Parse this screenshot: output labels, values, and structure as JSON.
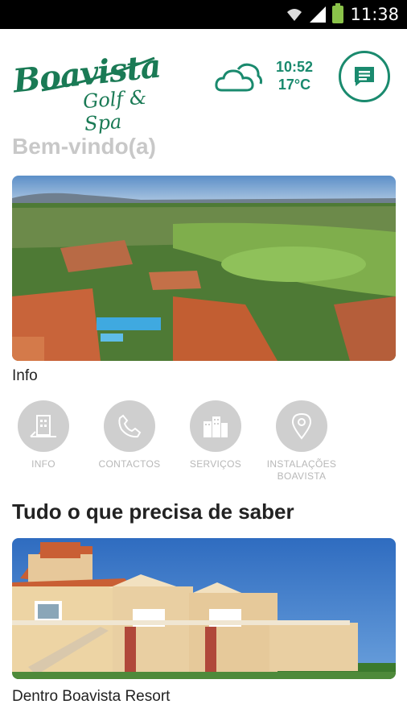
{
  "status_bar": {
    "time": "11:38"
  },
  "header": {
    "logo_main": "Boavista",
    "logo_sub": "Golf & Spa",
    "weather_time": "10:52",
    "weather_temp": "17°C",
    "weather_icon": "cloud-icon",
    "chat_icon": "chat-icon"
  },
  "welcome": "Bem-vindo(a)",
  "hero": {
    "caption": "Info"
  },
  "services": [
    {
      "label": "INFO",
      "icon": "building-icon"
    },
    {
      "label": "CONTACTOS",
      "icon": "phone-icon"
    },
    {
      "label": "SERVIÇOS",
      "icon": "city-icon"
    },
    {
      "label": "INSTALAÇÕES BOAVISTA",
      "icon": "location-pin-icon"
    }
  ],
  "section_title": "Tudo o que precisa de saber",
  "card": {
    "caption": "Dentro Boavista Resort"
  },
  "colors": {
    "brand_green": "#1a8a6e",
    "logo_green": "#1a7a55",
    "icon_grey": "#cfcfcf"
  }
}
